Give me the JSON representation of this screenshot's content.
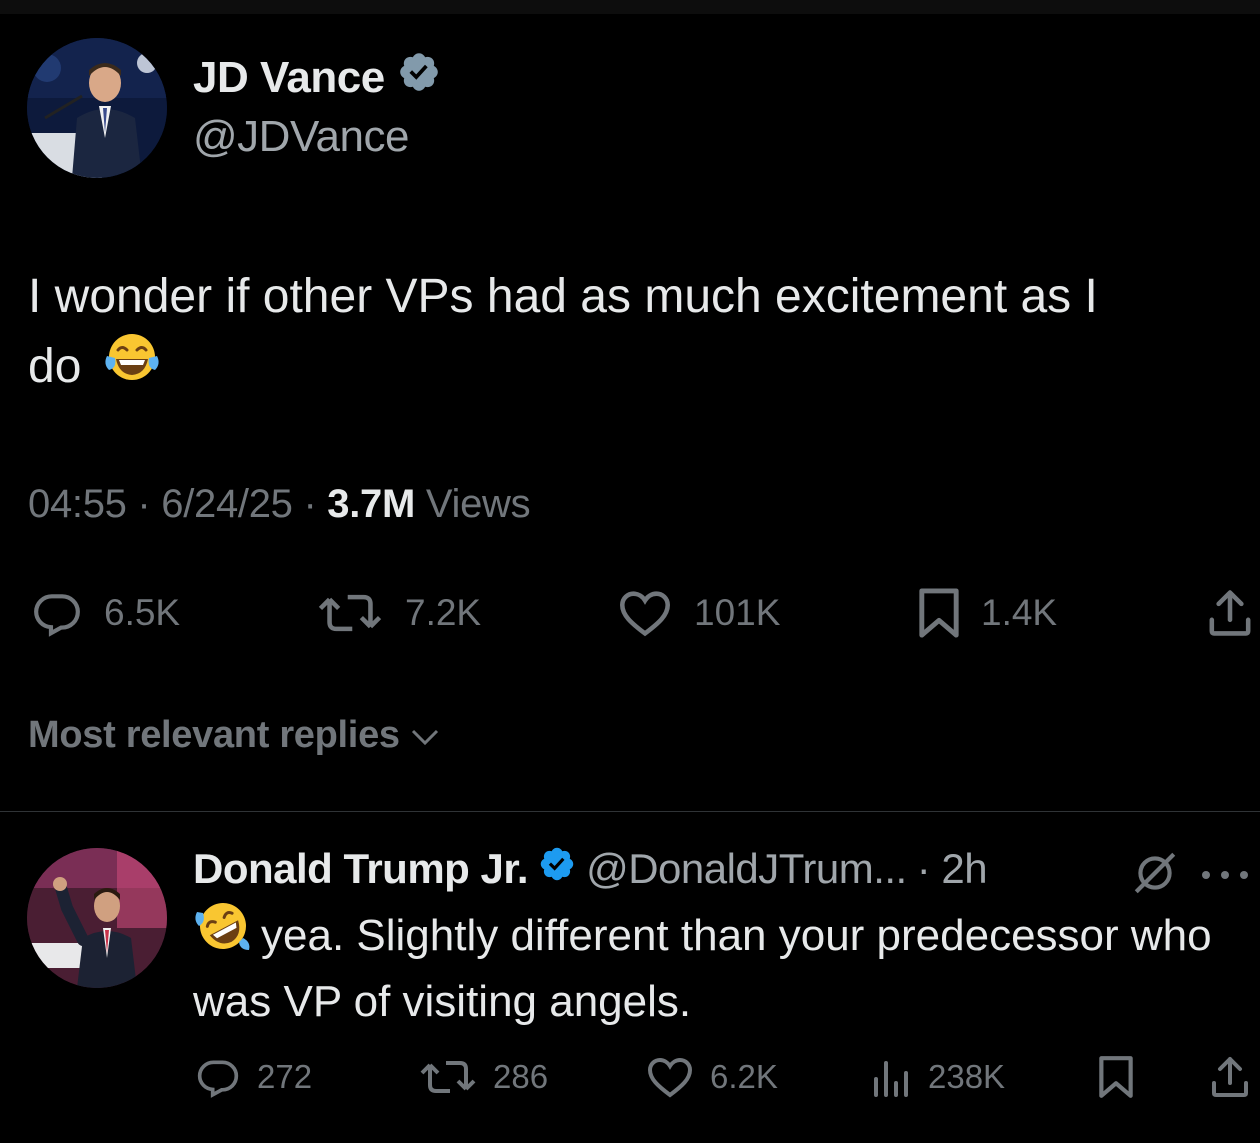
{
  "tweet": {
    "author_name": "JD Vance",
    "author_handle": "@JDVance",
    "text_line1": "I wonder if other VPs had as much excitement as I",
    "text_line2": "do",
    "time": "04:55",
    "sep1": " · ",
    "date": "6/24/25",
    "sep2": " · ",
    "views_count": "3.7M",
    "views_label": " Views",
    "actions": {
      "replies": "6.5K",
      "reposts": "7.2K",
      "likes": "101K",
      "bookmarks": "1.4K"
    }
  },
  "replies_sort": {
    "label": "Most relevant replies"
  },
  "reply": {
    "author_name": "Donald Trump Jr.",
    "author_handle": "@DonaldJTrum...",
    "time": "· 2h",
    "text": "yea. Slightly different than your predecessor who was VP of visiting angels.",
    "actions": {
      "replies": "272",
      "reposts": "286",
      "likes": "6.2K",
      "views": "238K"
    }
  },
  "colors": {
    "background": "#000000",
    "text_primary": "#e7e9ea",
    "text_secondary": "#71767b",
    "verified_main": "#829aab",
    "verified_reply": "#1d9bf0",
    "divider": "#2f3336"
  },
  "icons": [
    "verified-badge-icon",
    "reply-icon",
    "repost-icon",
    "like-icon",
    "bookmark-icon",
    "share-icon",
    "views-icon",
    "grok-icon",
    "more-icon",
    "chevron-down-icon",
    "face-with-tears-of-joy-emoji",
    "rolling-on-floor-laughing-emoji"
  ]
}
